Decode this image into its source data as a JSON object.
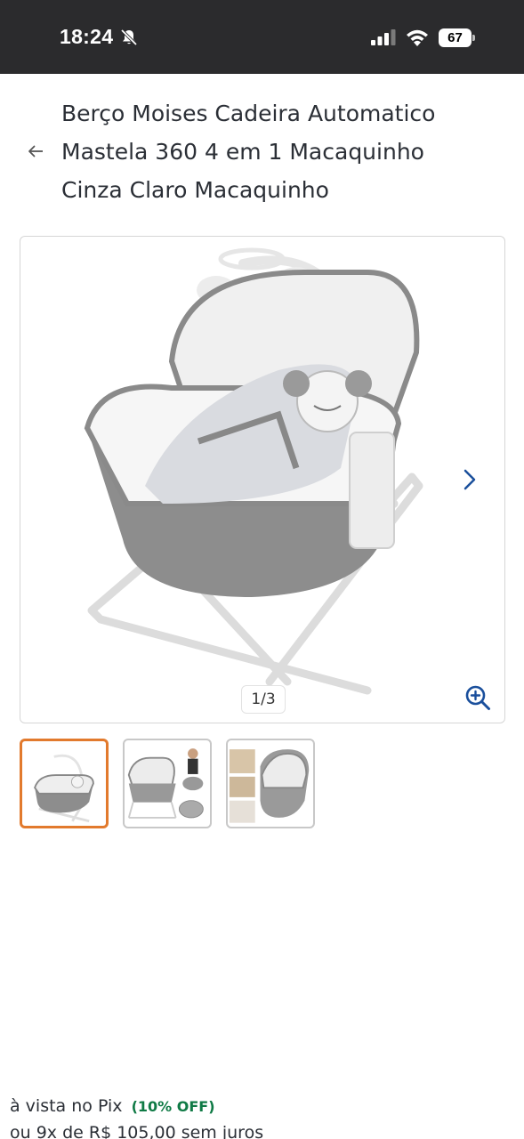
{
  "status_bar": {
    "time": "18:24",
    "battery": "67",
    "icons": [
      "bell-slash-icon",
      "cellular-signal-icon",
      "wifi-icon",
      "battery-icon"
    ]
  },
  "header": {
    "back_icon": "arrow-left-icon",
    "title": "Berço Moises Cadeira Automatico Mastela 360 4 em 1 Macaquinho Cinza Claro Macaquinho"
  },
  "gallery": {
    "counter": "1/3",
    "next_icon": "chevron-right-icon",
    "zoom_icon": "zoom-in-icon",
    "thumbnails_count": 3,
    "active_thumbnail": 1
  },
  "price": {
    "pix_text": "à vista no Pix",
    "pix_discount": "(10% OFF)",
    "installments": "ou 9x de R$ 105,00 sem juros"
  },
  "colors": {
    "status_bar_bg": "#2b2b2d",
    "accent_blue": "#1a4f9c",
    "active_thumb_border": "#e27a2d",
    "discount_green": "#0f7a45"
  }
}
